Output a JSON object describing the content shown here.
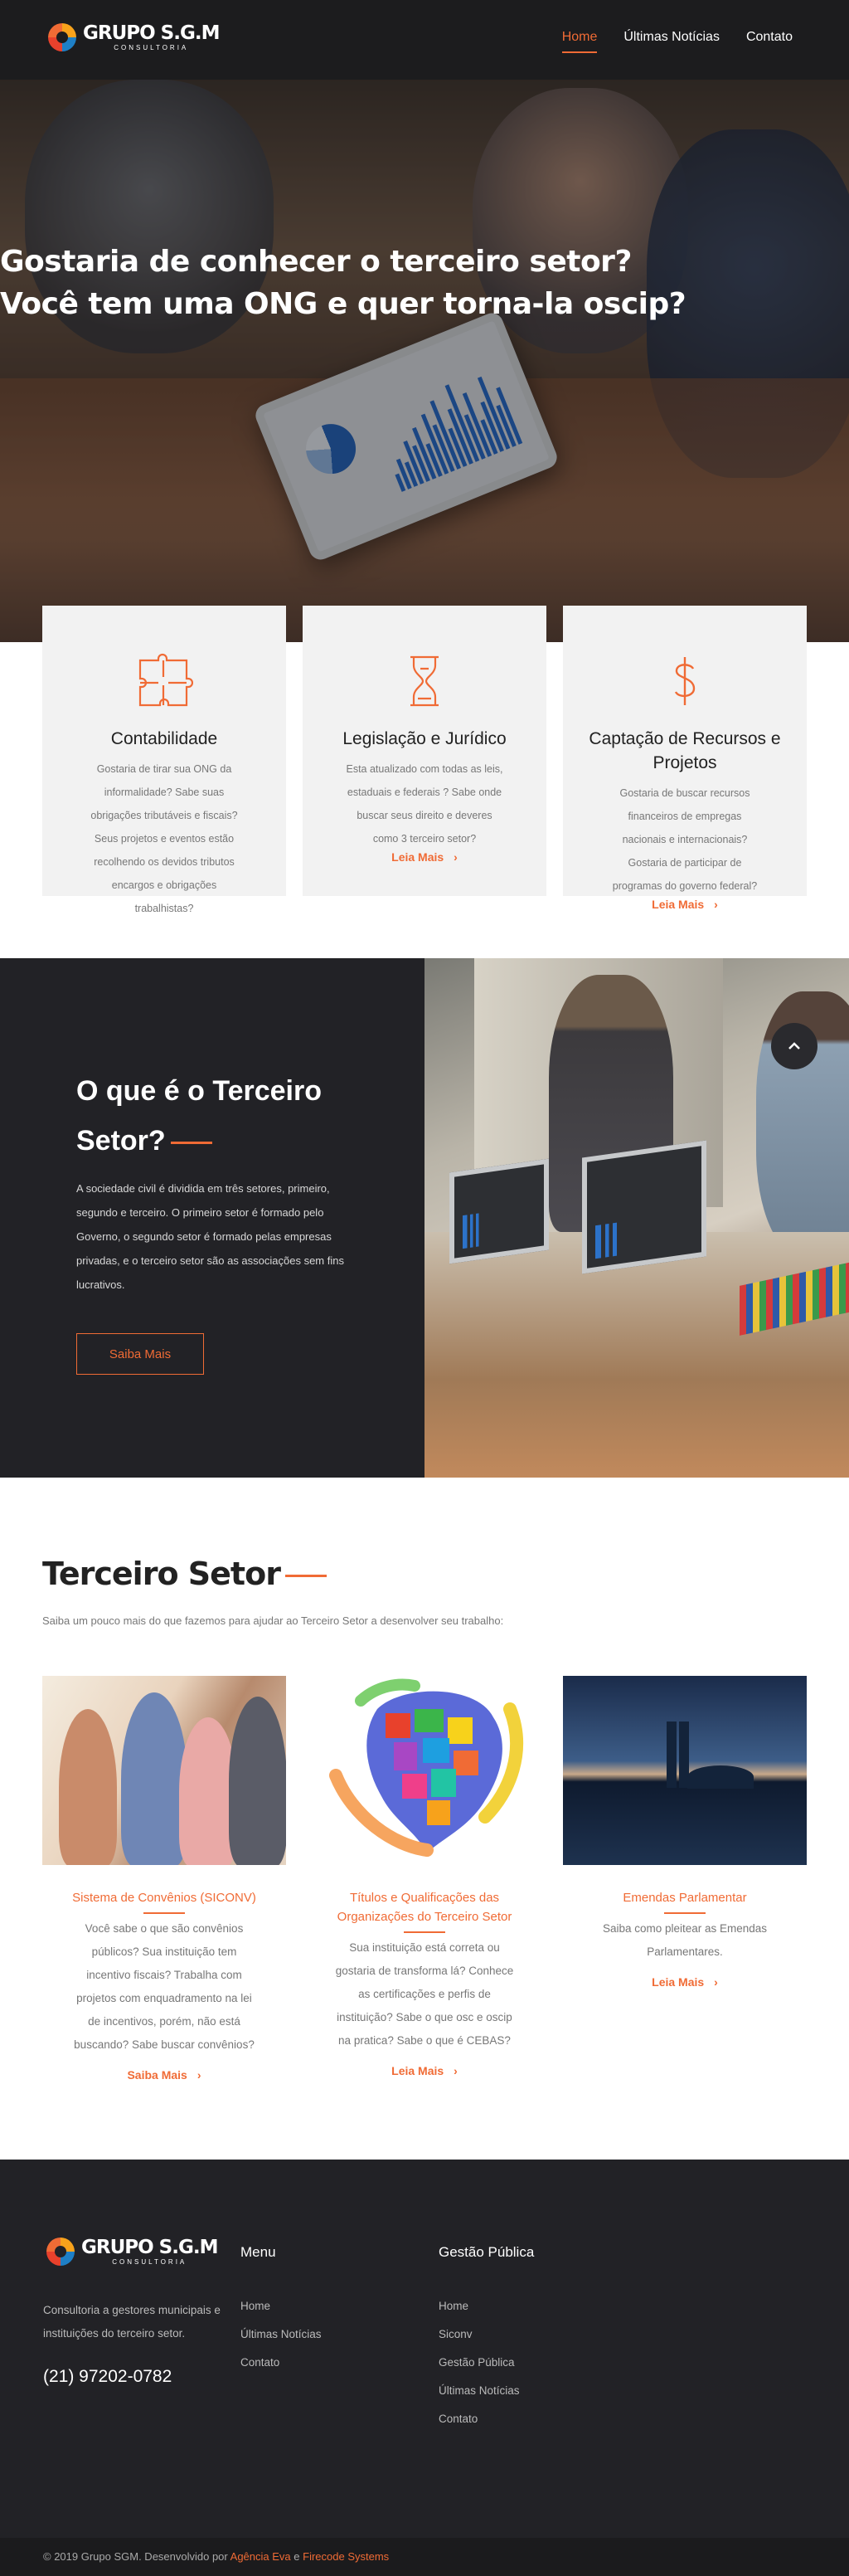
{
  "brand": {
    "name": "GRUPO S.G.M",
    "tagline": "CONSULTORIA",
    "accent_color": "#f06b35",
    "dark_color": "#222226"
  },
  "nav": {
    "items": [
      {
        "label": "Home",
        "active": true
      },
      {
        "label": "Últimas Notícias",
        "active": false
      },
      {
        "label": "Contato",
        "active": false
      }
    ]
  },
  "hero": {
    "title_line1": "Gostaria de conhecer o terceiro setor?",
    "title_line2": "Você tem uma ONG e quer torna-la oscip?"
  },
  "cards": [
    {
      "icon": "puzzle-icon",
      "title": "Contabilidade",
      "text": "Gostaria de tirar sua ONG da informalidade? Sabe suas obrigações tributáveis e fiscais? Seus projetos e eventos estão recolhendo os devidos tributos encargos e obrigações trabalhistas?",
      "more": ""
    },
    {
      "icon": "hourglass-icon",
      "title": "Legislação e Jurídico",
      "text": "Esta atualizado com todas as leis, estaduais e federais ? Sabe onde buscar seus direito e deveres como 3 terceiro setor?",
      "more": "Leia Mais"
    },
    {
      "icon": "dollar-icon",
      "title": "Captação de Recursos e Projetos",
      "text": "Gostaria de buscar recursos financeiros de empregas nacionais e internacionais? Gostaria de participar de programas do governo federal?",
      "more": "Leia Mais"
    }
  ],
  "about": {
    "title": "O que é o Terceiro Setor?",
    "text": "A sociedade civil é dividida em três setores, primeiro, segundo e terceiro. O primeiro setor é formado pelo Governo, o segundo setor é formado pelas empresas privadas, e o terceiro setor são as associações sem fins lucrativos.",
    "button": "Saiba Mais"
  },
  "section": {
    "title": "Terceiro Setor",
    "subtitle": "Saiba um pouco mais do que fazemos para ajudar ao Terceiro Setor a desenvolver seu trabalho:"
  },
  "posts": [
    {
      "title": "Sistema de Convênios (SICONV)",
      "text": "Você sabe o que são convênios públicos? Sua instituição tem incentivo fiscais? Trabalha com projetos com enquadramento na lei de incentivos, porém, não está buscando? Sabe buscar convênios?",
      "more": "Saiba Mais"
    },
    {
      "title": "Títulos e Qualificações das Organizações do Terceiro Setor",
      "text": "Sua instituição está correta ou gostaria de transforma lá? Conhece as certificações e perfis de instituição? Sabe o que osc e oscip na pratica? Sabe o que é CEBAS?",
      "more": "Leia Mais"
    },
    {
      "title": "Emendas Parlamentar",
      "text": "Saiba como pleitear as Emendas Parlamentares.",
      "more": "Leia Mais"
    }
  ],
  "footer": {
    "description": "Consultoria a gestores municipais e instituições do terceiro setor.",
    "phone": "(21) 97202-0782",
    "menu_title": "Menu",
    "menu_items": [
      "Home",
      "Últimas Notícias",
      "Contato"
    ],
    "gestao_title": "Gestão Pública",
    "gestao_items": [
      "Home",
      "Siconv",
      "Gestão Pública",
      "Últimas Notícias",
      "Contato"
    ],
    "copyright": "© 2019 Grupo SGM. Desenvolvido por",
    "dev1": "Agência Eva",
    "and": "e",
    "dev2": "Firecode Systems"
  }
}
